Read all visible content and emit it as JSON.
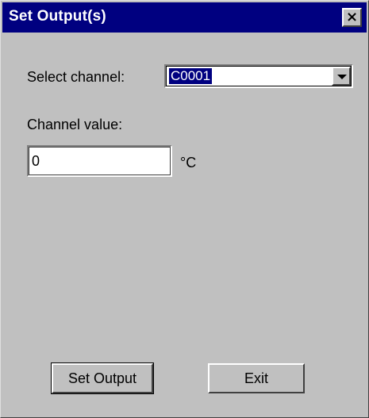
{
  "window": {
    "title": "Set Output(s)",
    "close_label": "×"
  },
  "select_channel": {
    "label": "Select channel:",
    "value": "C0001"
  },
  "channel_value": {
    "label": "Channel value:",
    "value": "0",
    "unit": "°C"
  },
  "buttons": {
    "set_output": "Set Output",
    "exit": "Exit"
  }
}
